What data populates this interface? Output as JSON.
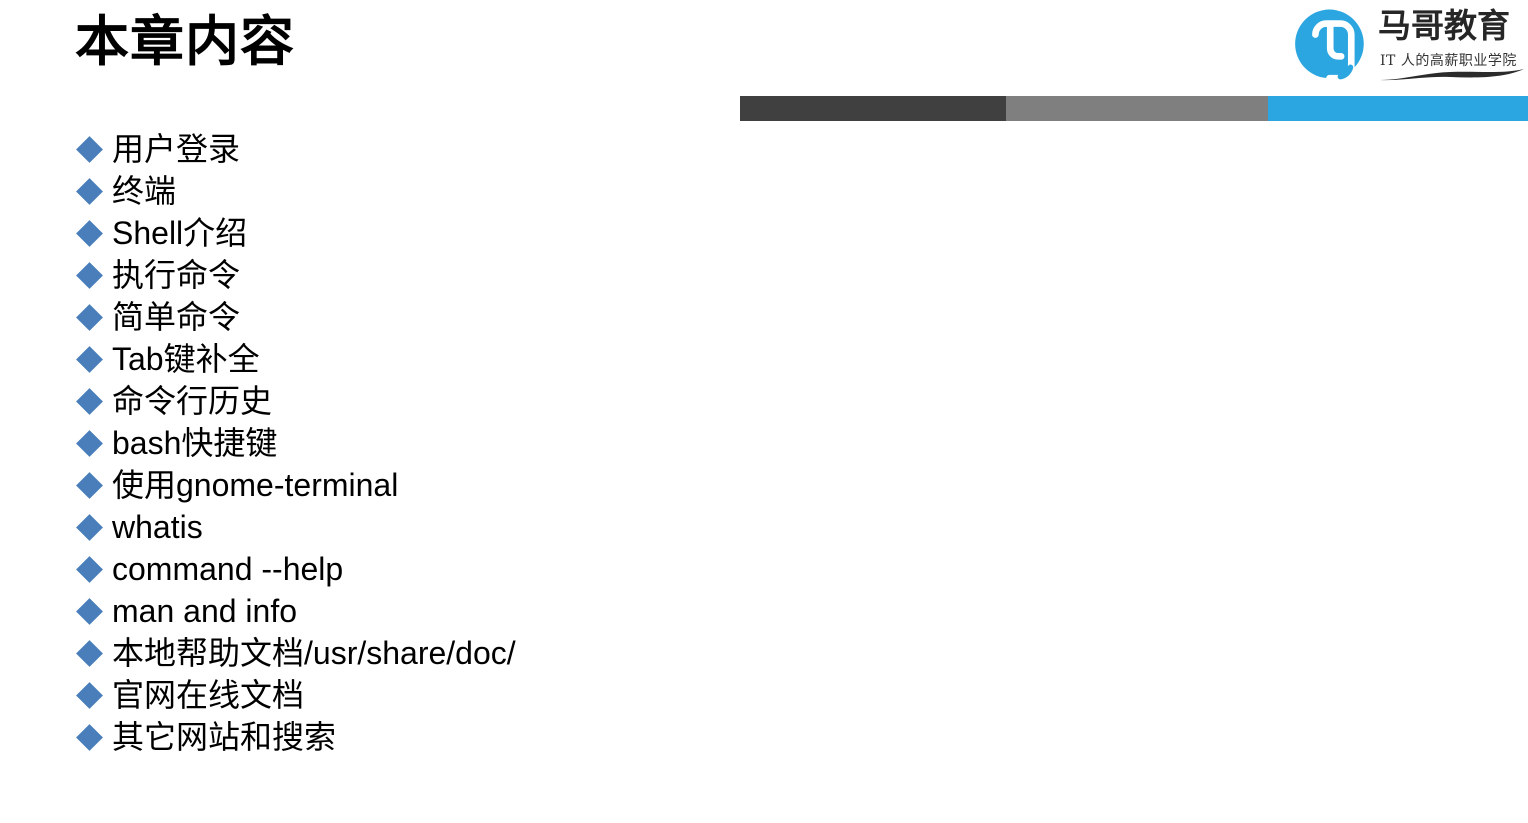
{
  "slide": {
    "title": "本章内容",
    "background_color": "#ffffff",
    "text_color": "#000000"
  },
  "decoration_bar": {
    "segments": [
      {
        "name": "dark-segment",
        "color": "#404040"
      },
      {
        "name": "gray-segment",
        "color": "#7f7f7f"
      },
      {
        "name": "blue-segment",
        "color": "#2ba6e0"
      }
    ]
  },
  "logo": {
    "mark_icon": "magedu-circle-logo-icon",
    "mark_color": "#2ba6e0",
    "wordmark": "马哥教育",
    "wordmark_color": "#262626",
    "tagline": "IT 人的高薪职业学院",
    "swoosh_icon": "brush-stroke-icon"
  },
  "bullets": {
    "marker_icon": "diamond-bullet-icon",
    "marker_color": "#4a7ebb",
    "items": [
      {
        "label": "用户登录"
      },
      {
        "label": "终端"
      },
      {
        "label": "Shell介绍"
      },
      {
        "label": "执行命令"
      },
      {
        "label": "简单命令"
      },
      {
        "label": "Tab键补全"
      },
      {
        "label": "命令行历史"
      },
      {
        "label": "bash快捷键"
      },
      {
        "label": "使用gnome-terminal"
      },
      {
        "label": "whatis"
      },
      {
        "label": "command --help"
      },
      {
        "label": "man and info"
      },
      {
        "label": "本地帮助文档/usr/share/doc/"
      },
      {
        "label": "官网在线文档"
      },
      {
        "label": "其它网站和搜索"
      }
    ]
  }
}
